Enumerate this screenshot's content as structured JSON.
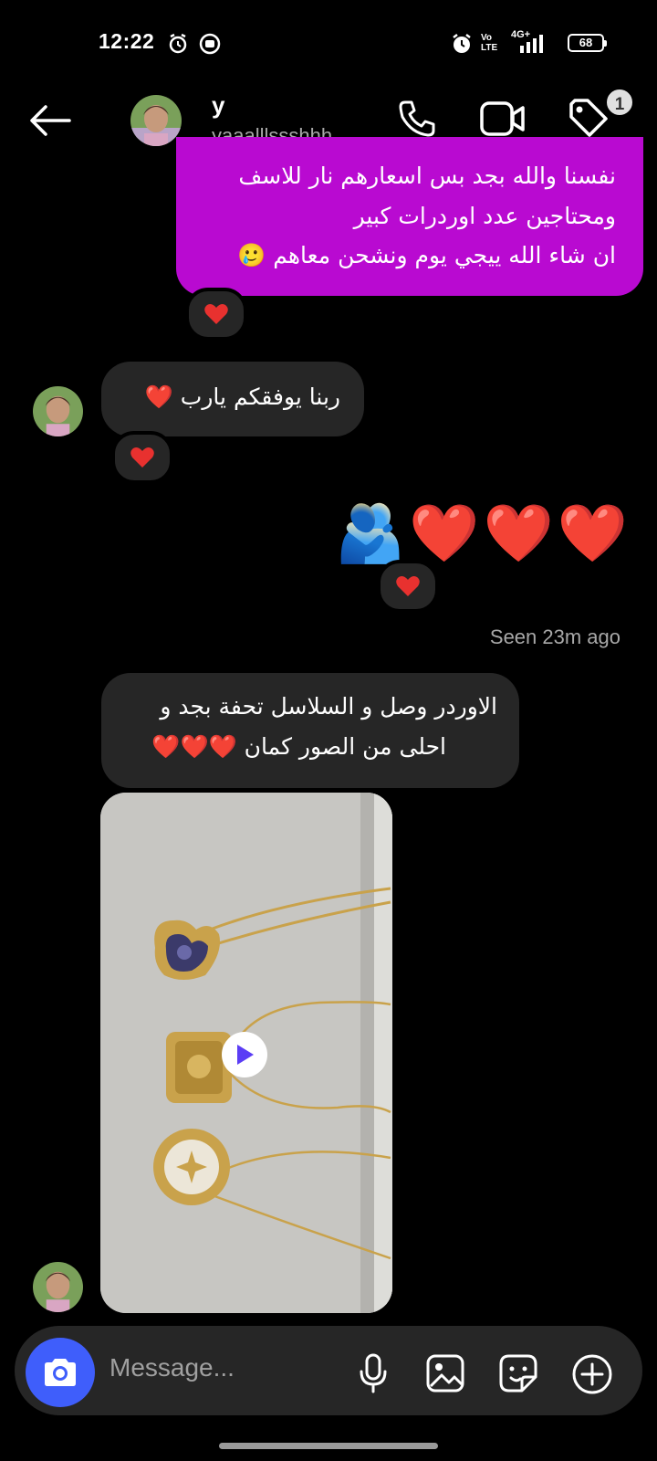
{
  "status_bar": {
    "time": "12:22",
    "battery": "68",
    "network": "4G+",
    "volte": "Vo LTE",
    "icons": [
      "alarm-icon",
      "screen-record-icon",
      "alarm-clock-icon",
      "signal-icon",
      "battery-icon"
    ]
  },
  "header": {
    "name": "y",
    "username": "yaaalllssshhh",
    "badge_count": "1",
    "icons": [
      "back-arrow-icon",
      "phone-icon",
      "video-camera-icon",
      "tag-icon"
    ]
  },
  "messages": {
    "outgoing_1": {
      "lines": [
        "نفسنا والله بجد بس اسعارهم نار للاسف",
        "ومحتاجين عدد اوردرات كبير",
        "ان شاء الله ييجي يوم ونشحن معاهم 🥲"
      ],
      "reaction": "❤️"
    },
    "incoming_1": {
      "text": "ربنا يوفقكم يارب ❤️",
      "reaction": "❤️"
    },
    "outgoing_2": {
      "text": "🫂❤️❤️❤️",
      "reaction": "❤️"
    },
    "seen": "Seen 23m ago",
    "incoming_2": {
      "lines": [
        "الاوردر وصل و السلاسل تحفة بجد و",
        "احلى من الصور كمان ❤️❤️❤️"
      ]
    },
    "incoming_3": {
      "type": "video",
      "icon": "play-icon"
    }
  },
  "composer": {
    "placeholder": "Message...",
    "icons": [
      "camera-icon",
      "microphone-icon",
      "gallery-icon",
      "sticker-icon",
      "plus-icon"
    ]
  },
  "colors": {
    "background": "#000000",
    "outgoing_bubble": "#b90ad1",
    "incoming_bubble": "#262626",
    "camera_button": "#3f5efb",
    "secondary_text": "#a8a8a8",
    "heart": "#e8312f"
  }
}
